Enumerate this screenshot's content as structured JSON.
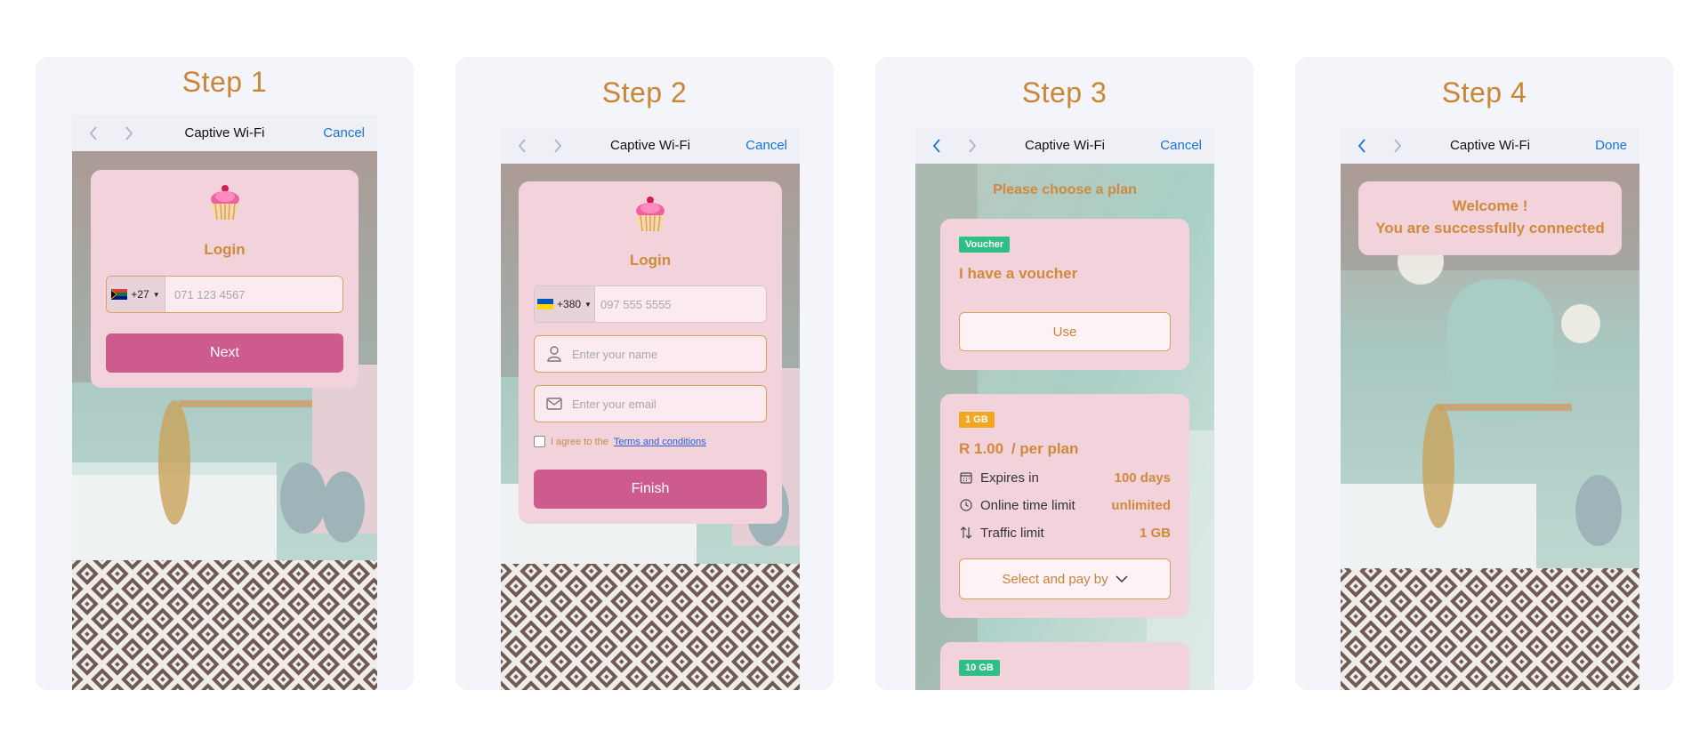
{
  "steps": [
    {
      "title": "Step 1"
    },
    {
      "title": "Step 2"
    },
    {
      "title": "Step 3"
    },
    {
      "title": "Step 4"
    }
  ],
  "navbar": {
    "title": "Captive Wi-Fi",
    "cancel": "Cancel",
    "done": "Done"
  },
  "step1": {
    "login_title": "Login",
    "country_code": "+27",
    "phone_placeholder": "071 123 4567",
    "next_label": "Next"
  },
  "step2": {
    "login_title": "Login",
    "country_code": "+380",
    "phone_placeholder": "097 555 5555",
    "name_placeholder": "Enter your name",
    "email_placeholder": "Enter your email",
    "agree_text": "I agree to the",
    "terms_link": "Terms and conditions",
    "finish_label": "Finish"
  },
  "step3": {
    "heading": "Please choose a plan",
    "voucher": {
      "badge": "Voucher",
      "name": "I have a voucher",
      "button": "Use"
    },
    "plan1": {
      "badge": "1 GB",
      "price": "R 1.00",
      "per": "/ per plan",
      "rows": [
        {
          "label": "Expires in",
          "value": "100 days"
        },
        {
          "label": "Online time limit",
          "value": "unlimited"
        },
        {
          "label": "Traffic limit",
          "value": "1 GB"
        }
      ],
      "button": "Select and pay by"
    },
    "plan2": {
      "badge": "10 GB"
    }
  },
  "step4": {
    "welcome_line1": "Welcome !",
    "welcome_line2": "You are successfully connected"
  },
  "colors": {
    "accent": "#cf8a3a",
    "button": "#cd5b8e",
    "card": "#f2d3dc",
    "link": "#1a73d6"
  }
}
